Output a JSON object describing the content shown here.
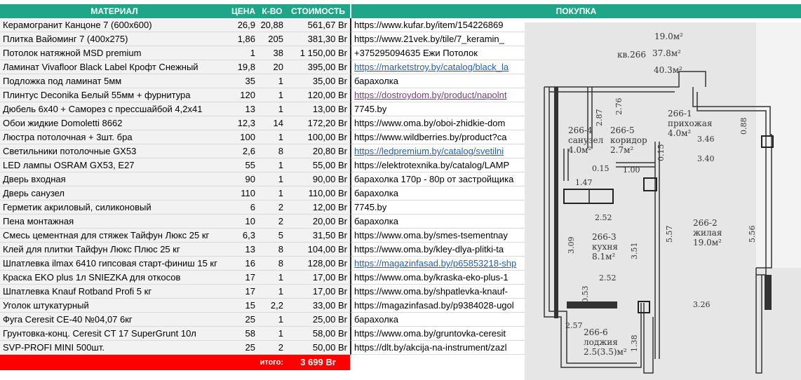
{
  "header": {
    "material": "МАТЕРИАЛ",
    "price": "ЦЕНА",
    "qty": "К-ВО",
    "cost": "СТОИМОСТЬ",
    "purchase": "ПОКУПКА"
  },
  "rows": [
    {
      "name": "Керамогранит Канцоне 7 (600х600)",
      "price": "26,9",
      "qty": "20,88",
      "cost": "561,67 Br",
      "buy": "https://www.kufar.by/item/154226869",
      "style": "plain"
    },
    {
      "name": "Плитка Вайоминг 7 (400х275)",
      "price": "1,86",
      "qty": "205",
      "cost": "381,30 Br",
      "buy": "https://www.21vek.by/tile/7_keramin_",
      "style": "plain"
    },
    {
      "name": "Потолок натяжной MSD premium",
      "price": "1",
      "qty": "38",
      "cost": "1 150,00 Br",
      "buy": "+375295094635 Ежи Потолок",
      "style": "plain"
    },
    {
      "name": "Ламинат Vivafloor Black Label Крофт Снежный",
      "price": "19,8",
      "qty": "20",
      "cost": "395,00 Br",
      "buy": "https://marketstroy.by/catalog/black_la",
      "style": "link"
    },
    {
      "name": "Подложка под ламинат  5мм",
      "price": "35",
      "qty": "1",
      "cost": "35,00 Br",
      "buy": "барахолка",
      "style": "plain"
    },
    {
      "name": "Плинтус Deconika Белый 55мм + фурнитура",
      "price": "120",
      "qty": "1",
      "cost": "120,00 Br",
      "buy": "https://dostroydom.by/product/napolnt",
      "style": "visited"
    },
    {
      "name": "Дюбель 6х40 + Саморез с прессшайбой 4,2х41",
      "price": "13",
      "qty": "1",
      "cost": "13,00 Br",
      "buy": "7745.by",
      "style": "plain"
    },
    {
      "name": "Обои жидкие Domoletti 8662",
      "price": "12,3",
      "qty": "14",
      "cost": "172,20 Br",
      "buy": "https://www.oma.by/oboi-zhidkie-dom",
      "style": "plain"
    },
    {
      "name": "Люстра потолочная + 3шт. бра",
      "price": "100",
      "qty": "1",
      "cost": "100,00 Br",
      "buy": "https://www.wildberries.by/product?ca",
      "style": "plain"
    },
    {
      "name": "Светильники потолочные GX53",
      "price": "2,6",
      "qty": "8",
      "cost": "20,80 Br",
      "buy": "https://ledpremium.by/catalog/svetilni",
      "style": "link"
    },
    {
      "name": "LED лампы OSRAM GX53, E27",
      "price": "55",
      "qty": "1",
      "cost": "55,00 Br",
      "buy": "https://elektrotexnika.by/catalog/LAMP",
      "style": "plain"
    },
    {
      "name": "Дверь входная",
      "price": "90",
      "qty": "1",
      "cost": "90,00 Br",
      "buy": "барахолка 170р - 80р от застройщика",
      "style": "plain"
    },
    {
      "name": "Дверь санузел",
      "price": "110",
      "qty": "1",
      "cost": "110,00 Br",
      "buy": "барахолка",
      "style": "plain"
    },
    {
      "name": "Герметик акриловый, силиконовый",
      "price": "6",
      "qty": "2",
      "cost": "12,00 Br",
      "buy": "7745.by",
      "style": "plain"
    },
    {
      "name": "Пена монтажная",
      "price": "10",
      "qty": "2",
      "cost": "20,00 Br",
      "buy": "барахолка",
      "style": "plain"
    },
    {
      "name": "Смесь цементная для стяжек Тайфун Люкс 25 кг",
      "price": "6,3",
      "qty": "5",
      "cost": "31,50 Br",
      "buy": "https://www.oma.by/smes-tsementnay",
      "style": "plain"
    },
    {
      "name": "Клей для плитки Тайфун Люкс Плюс 25 кг",
      "price": "13",
      "qty": "8",
      "cost": "104,00 Br",
      "buy": "https://www.oma.by/kley-dlya-plitki-ta",
      "style": "plain"
    },
    {
      "name": "Шпатлевка ilmax 6410 гипсовая старт-финиш 15 кг",
      "price": "16",
      "qty": "8",
      "cost": "128,00 Br",
      "buy": "https://magazinfasad.by/p65853218-shp",
      "style": "link"
    },
    {
      "name": "Краска EKO plus 1л SNIEZKA для откосов",
      "price": "17",
      "qty": "1",
      "cost": "17,00 Br",
      "buy": "https://www.oma.by/kraska-eko-plus-1",
      "style": "plain"
    },
    {
      "name": "Шпатлевка Knauf Rotband Profi 5 кг",
      "price": "17",
      "qty": "1",
      "cost": "17,00 Br",
      "buy": "https://www.oma.by/shpatlevka-knauf-",
      "style": "plain"
    },
    {
      "name": "Уголок штукатурный",
      "price": "15",
      "qty": "2,2",
      "cost": "33,00 Br",
      "buy": "https://magazinfasad.by/p9384028-ugol",
      "style": "plain"
    },
    {
      "name": "Фуга Ceresit CE-40  №04,07  6кг",
      "price": "25",
      "qty": "1",
      "cost": "25,00 Br",
      "buy": "барахолка",
      "style": "plain"
    },
    {
      "name": "Грунтовка-конц. Ceresit CT 17 SuperGrunt 10л",
      "price": "58",
      "qty": "1",
      "cost": "58,00 Br",
      "buy": "https://www.oma.by/gruntovka-ceresit",
      "style": "plain"
    },
    {
      "name": "SVP-PROFI MINI 500шт.",
      "price": "25",
      "qty": "2",
      "cost": "50,00 Br",
      "buy": "https://dlt.by/akcija-na-instrument/zazl",
      "style": "plain"
    }
  ],
  "total": {
    "label": "итого:",
    "value": "3 699 Br"
  },
  "floorplan": {
    "top_area": "19.0м²",
    "apt": "кв.266",
    "apt_area1": "37.8м²",
    "apt_area2": "40.3м²",
    "rooms": [
      {
        "id": "266-4",
        "name": "санузел",
        "area": "4.0м²"
      },
      {
        "id": "266-5",
        "name": "коридор",
        "area": "2.7м²"
      },
      {
        "id": "266-1",
        "name": "прихожая",
        "area": "4.0м²"
      },
      {
        "id": "266-3",
        "name": "кухня",
        "area": "8.1м²"
      },
      {
        "id": "266-2",
        "name": "жилая",
        "area": "19.0м²"
      },
      {
        "id": "266-6",
        "name": "лоджия",
        "area": "2.5(3.5)м²"
      }
    ],
    "dims": [
      "2.87",
      "2.76",
      "0.88",
      "3.46",
      "3.40",
      "0.15",
      "1.00",
      "0.15",
      "1.47",
      "2.52",
      "3.09",
      "3.51",
      "5.57",
      "5.56",
      "2.52",
      "0.53",
      "3.26",
      "2.57",
      "1.38"
    ]
  },
  "colors": {
    "header_bg": "#1fa588",
    "total_bg": "#ff0000",
    "link": "#1f5fbf",
    "visited": "#7a3b8c"
  }
}
